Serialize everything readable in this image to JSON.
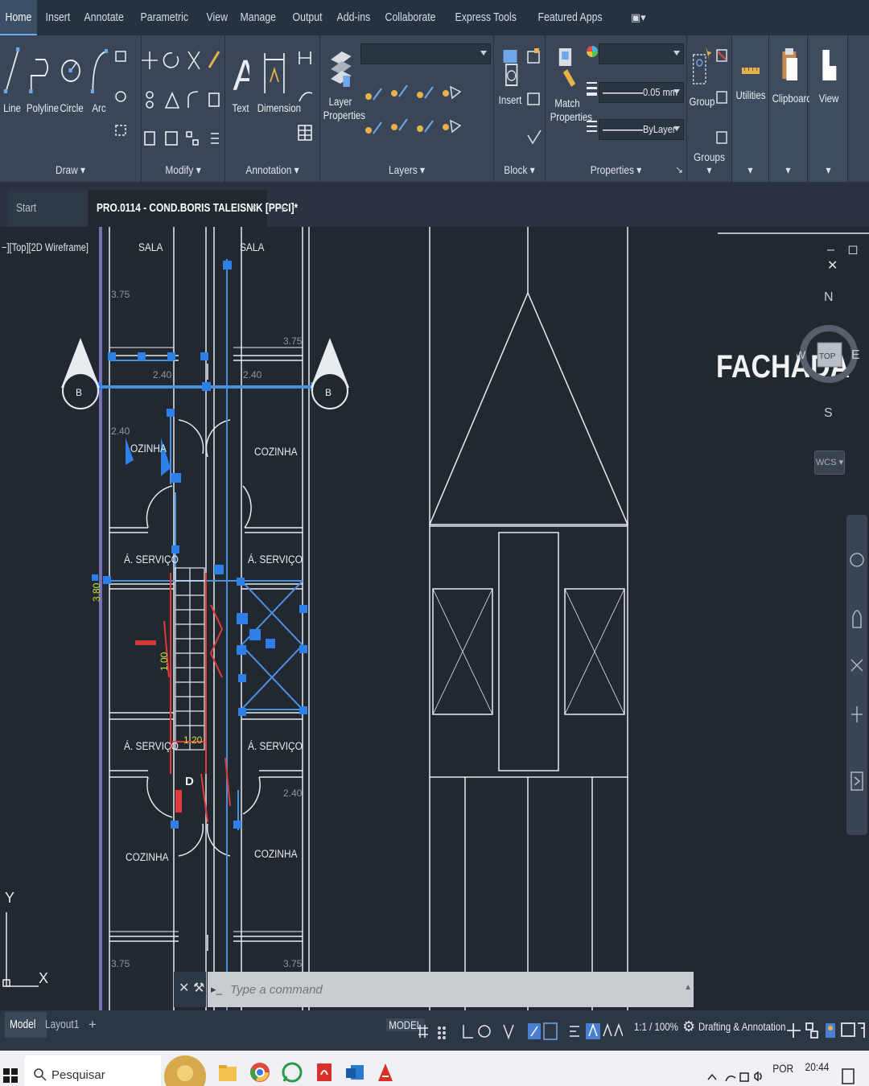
{
  "ribbon": {
    "tabs": [
      "Home",
      "Insert",
      "Annotate",
      "Parametric",
      "View",
      "Manage",
      "Output",
      "Add-ins",
      "Collaborate",
      "Express Tools",
      "Featured Apps"
    ],
    "active_tab": "Home",
    "draw": {
      "title": "Draw ▾",
      "line": "Line",
      "polyline": "Polyline",
      "circle": "Circle",
      "arc": "Arc"
    },
    "modify": {
      "title": "Modify ▾"
    },
    "annotation": {
      "title": "Annotation ▾",
      "text": "Text",
      "dimension": "Dimension"
    },
    "layers": {
      "title": "Layers ▾",
      "layer_properties_1": "Layer",
      "layer_properties_2": "Properties"
    },
    "block": {
      "title": "Block ▾",
      "insert": "Insert"
    },
    "properties": {
      "title": "Properties ▾",
      "match_1": "Match",
      "match_2": "Properties",
      "lineweight": "0.05 mm",
      "linetype": "ByLayer"
    },
    "groups": {
      "title": "Groups ▾",
      "group": "Group"
    },
    "utilities": "Utilities",
    "clipboard": "Clipboard",
    "view": "View"
  },
  "doc_tabs": {
    "start": "Start",
    "file": "PRO.0114 - COND.BORIS TALEISNIK [PPCI]*",
    "close": "×",
    "add": "+"
  },
  "viewport": {
    "label": "−][Top][2D Wireframe]",
    "window_controls": "‒ ◻ ✕"
  },
  "viewcube": {
    "n": "N",
    "s": "S",
    "e": "E",
    "w": "W",
    "top": "TOP",
    "wcs": "WCS ▾"
  },
  "drawing": {
    "fachada": "FACHADA",
    "rooms": {
      "sala_left": "SALA",
      "sala_right": "SALA",
      "cozinha_tl": "OZINHA",
      "cozinha_tr": "COZINHA",
      "servico_1": "Á. SERVIÇO",
      "servico_2": "Á. SERVIÇO",
      "servico_3": "Á. SERVIÇO",
      "servico_4": "Á. SERVIÇO",
      "cozinha_bl": "COZINHA",
      "cozinha_br": "COZINHA"
    },
    "dims": {
      "d375_a": "3.75",
      "d375_b": "3.75",
      "d375_c": "3.75",
      "d375_d": "3.75",
      "d240_a": "2.40",
      "d240_b": "2.40",
      "d240_c": "2.40",
      "d240_d": "2.40",
      "d380": "3.80",
      "d100": "1.00",
      "d120": "1.20"
    },
    "section_marks": {
      "left": "B",
      "right": "B"
    },
    "door_label": "D",
    "ucs_x": "X",
    "ucs_y": "Y"
  },
  "command": {
    "placeholder": "Type a command"
  },
  "status": {
    "model_tab": "Model",
    "layout_tab": "Layout1",
    "add_tab": "+",
    "model_btn": "MODEL",
    "scale": "1:1 / 100%",
    "workspace": "Drafting & Annotation"
  },
  "taskbar": {
    "search": "Pesquisar",
    "lang": "POR",
    "time": "20:44"
  }
}
